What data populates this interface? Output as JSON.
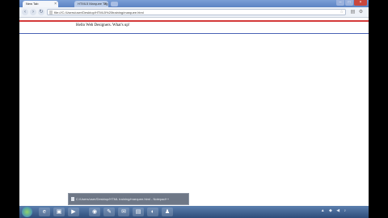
{
  "browser": {
    "tabs": [
      {
        "label": "New Tab",
        "active": true
      },
      {
        "label": "HTML5 Marquee Tag",
        "active": false
      }
    ],
    "address": "file:///C:/Users/user/Desktop/HTML5%20training/marquee.html"
  },
  "page": {
    "marquee_text": "Hello Web Designers. What's up!"
  },
  "download": {
    "filename": "C:/Users/user/Desktop/HTML training/marquee.html - Notepad++"
  },
  "taskbar": {
    "apps": [
      "ie-icon",
      "folder-icon",
      "media-icon",
      "chrome-icon",
      "paint-icon",
      "notepad-icon",
      "calc-icon",
      "firefox-icon",
      "app-icon"
    ]
  },
  "colors": {
    "marquee_top_border": "#d43a3a",
    "marquee_bottom_border": "#4a63b5"
  }
}
